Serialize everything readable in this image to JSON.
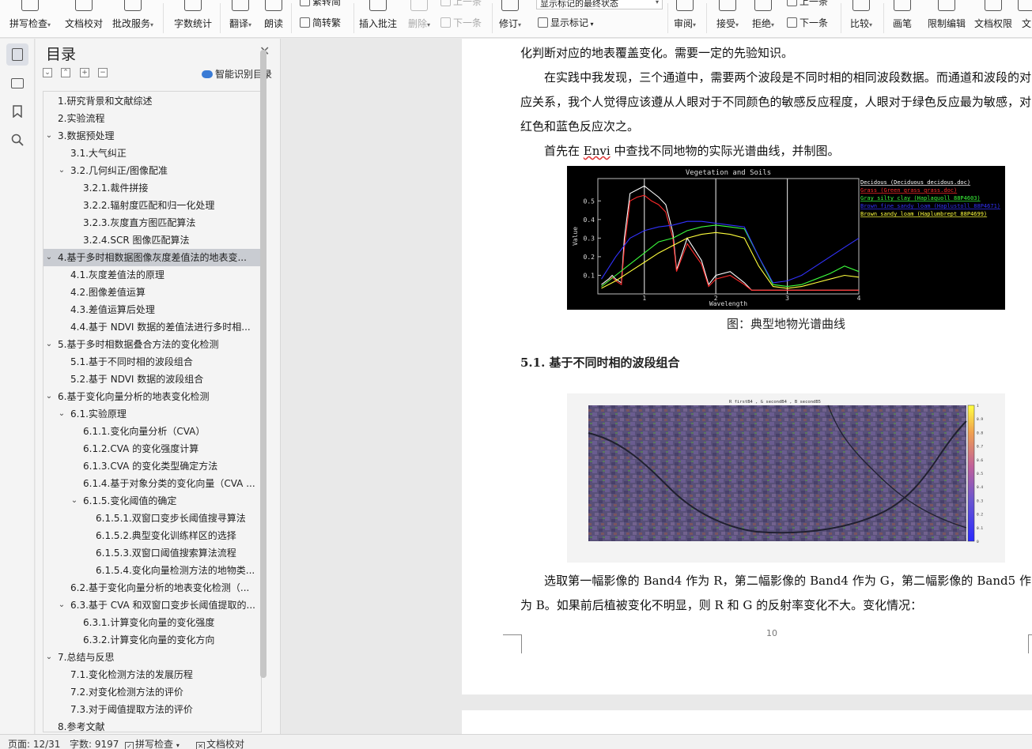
{
  "ribbon": {
    "buttons": [
      {
        "label": "拼写检查",
        "dropdown": true,
        "icon": "spellcheck-icon"
      },
      {
        "label": "文档校对",
        "dropdown": false,
        "icon": "proofread-icon"
      },
      {
        "label": "批改服务",
        "dropdown": true,
        "icon": "correction-service-icon"
      },
      {
        "label": "字数统计",
        "dropdown": false,
        "icon": "word-count-icon"
      },
      {
        "label": "翻译",
        "dropdown": true,
        "icon": "translate-icon"
      },
      {
        "label": "朗读",
        "dropdown": false,
        "icon": "read-aloud-icon"
      },
      {
        "label": "插入批注",
        "dropdown": false,
        "icon": "insert-comment-icon"
      },
      {
        "label": "删除",
        "dropdown": true,
        "icon": "delete-comment-icon",
        "disabled": true
      },
      {
        "label": "修订",
        "dropdown": true,
        "icon": "track-changes-icon"
      },
      {
        "label": "审阅",
        "dropdown": true,
        "icon": "review-icon"
      },
      {
        "label": "接受",
        "dropdown": true,
        "icon": "accept-icon"
      },
      {
        "label": "拒绝",
        "dropdown": true,
        "icon": "reject-icon"
      },
      {
        "label": "比较",
        "dropdown": true,
        "icon": "compare-icon"
      },
      {
        "label": "画笔",
        "dropdown": false,
        "icon": "pen-icon"
      },
      {
        "label": "限制编辑",
        "dropdown": false,
        "icon": "restrict-edit-icon"
      },
      {
        "label": "文档权限",
        "dropdown": false,
        "icon": "doc-permission-icon"
      },
      {
        "label": "文",
        "dropdown": false,
        "icon": "more-icon"
      }
    ],
    "traditional_top": "繁转简",
    "simplified_conv": "简转繁",
    "prev_top": "上一条",
    "next_top": "下一条",
    "markup_mode": "显示标记的最终状态",
    "show_markup": "显示标记",
    "prev_change": "上一条",
    "next_change": "下一条"
  },
  "toc": {
    "title": "目录",
    "smart_label": "智能识别目录",
    "items": [
      {
        "level": 1,
        "text": "1.研究背景和文献综述",
        "chevron": ""
      },
      {
        "level": 1,
        "text": "2.实验流程",
        "chevron": ""
      },
      {
        "level": 1,
        "text": "3.数据预处理",
        "chevron": "v"
      },
      {
        "level": 2,
        "text": "3.1.大气纠正",
        "chevron": ""
      },
      {
        "level": 2,
        "text": "3.2.几何纠正/图像配准",
        "chevron": "v"
      },
      {
        "level": 3,
        "text": "3.2.1.裁件拼接",
        "chevron": ""
      },
      {
        "level": 3,
        "text": "3.2.2.辐射度匹配和归一化处理",
        "chevron": ""
      },
      {
        "level": 3,
        "text": "3.2.3.灰度直方图匹配算法",
        "chevron": ""
      },
      {
        "level": 3,
        "text": "3.2.4.SCR 图像匹配算法",
        "chevron": ""
      },
      {
        "level": 1,
        "text": "4.基于多时相数据图像灰度差值法的地表变...",
        "chevron": "v",
        "selected": true
      },
      {
        "level": 2,
        "text": "4.1.灰度差值法的原理",
        "chevron": ""
      },
      {
        "level": 2,
        "text": "4.2.图像差值运算",
        "chevron": ""
      },
      {
        "level": 2,
        "text": "4.3.差值运算后处理",
        "chevron": ""
      },
      {
        "level": 2,
        "text": "4.4.基于 NDVI 数据的差值法进行多时相...",
        "chevron": ""
      },
      {
        "level": 1,
        "text": "5.基于多时相数据叠合方法的变化检测",
        "chevron": "v"
      },
      {
        "level": 2,
        "text": "5.1.基于不同时相的波段组合",
        "chevron": ""
      },
      {
        "level": 2,
        "text": "5.2.基于 NDVI 数据的波段组合",
        "chevron": ""
      },
      {
        "level": 1,
        "text": "6.基于变化向量分析的地表变化检测",
        "chevron": "v"
      },
      {
        "level": 2,
        "text": "6.1.实验原理",
        "chevron": "v"
      },
      {
        "level": 3,
        "text": "6.1.1.变化向量分析（CVA）",
        "chevron": ""
      },
      {
        "level": 3,
        "text": "6.1.2.CVA 的变化强度计算",
        "chevron": ""
      },
      {
        "level": 3,
        "text": "6.1.3.CVA 的变化类型确定方法",
        "chevron": ""
      },
      {
        "level": 3,
        "text": "6.1.4.基于对象分类的变化向量（CVA ...",
        "chevron": ""
      },
      {
        "level": 3,
        "text": "6.1.5.变化阈值的确定",
        "chevron": "v"
      },
      {
        "level": 4,
        "text": "6.1.5.1.双窗口变步长阈值搜寻算法",
        "chevron": ""
      },
      {
        "level": 4,
        "text": "6.1.5.2.典型变化训练样区的选择",
        "chevron": ""
      },
      {
        "level": 4,
        "text": "6.1.5.3.双窗口阈值搜索算法流程",
        "chevron": ""
      },
      {
        "level": 4,
        "text": "6.1.5.4.变化向量检测方法的地物类...",
        "chevron": ""
      },
      {
        "level": 2,
        "text": "6.2.基于变化向量分析的地表变化检测（...",
        "chevron": ""
      },
      {
        "level": 2,
        "text": "6.3.基于 CVA 和双窗口变步长阈值提取的...",
        "chevron": "v"
      },
      {
        "level": 3,
        "text": "6.3.1.计算变化向量的变化强度",
        "chevron": ""
      },
      {
        "level": 3,
        "text": "6.3.2.计算变化向量的变化方向",
        "chevron": ""
      },
      {
        "level": 1,
        "text": "7.总结与反思",
        "chevron": "v"
      },
      {
        "level": 2,
        "text": "7.1.变化检测方法的发展历程",
        "chevron": ""
      },
      {
        "level": 2,
        "text": "7.2.对变化检测方法的评价",
        "chevron": ""
      },
      {
        "level": 2,
        "text": "7.3.对于阈值提取方法的评价",
        "chevron": ""
      },
      {
        "level": 1,
        "text": "8.参考文献",
        "chevron": ""
      }
    ]
  },
  "doc": {
    "p1": "化判断对应的地表覆盖变化。需要一定的先验知识。",
    "p2": "在实践中我发现，三个通道中，需要两个波段是不同时相的相同波段数据。而通道和波段的对应关系，我个人觉得应该遵从人眼对于不同颜色的敏感反应程度，人眼对于绿色反应最为敏感，对红色和蓝色反应次之。",
    "p3_a": "首先在 ",
    "p3_b": "Envi",
    "p3_c": " 中查找不同地物的实际光谱曲线，并制图。",
    "fig1_caption": "图：典型地物光谱曲线",
    "section_title": "5.1. 基于不同时相的波段组合",
    "p4": "选取第一幅影像的 Band4 作为 R，第二幅影像的 Band4 作为 G，第二幅影像的 Band5 作为 B。如果前后植被变化不明显，则 R 和 G 的反射率变化不大。变化情况：",
    "page_number": "10"
  },
  "chart_data": {
    "type": "line",
    "title": "Vegetation and Soils",
    "xlabel": "Wavelength",
    "ylabel": "Value",
    "xlim": [
      0.35,
      4.0
    ],
    "ylim": [
      0,
      0.62
    ],
    "xticks": [
      "1",
      "2",
      "3",
      "4"
    ],
    "yticks": [
      "0.1",
      "0.2",
      "0.3",
      "0.4",
      "0.5"
    ],
    "background": "#000000",
    "legend_position": "right",
    "series": [
      {
        "name": "Decidous (Deciduous decidous.doc)",
        "color": "#ffffff",
        "x": [
          0.4,
          0.5,
          0.55,
          0.6,
          0.68,
          0.72,
          0.8,
          0.9,
          1.0,
          1.1,
          1.2,
          1.3,
          1.4,
          1.45,
          1.6,
          1.8,
          1.9,
          2.0,
          2.2,
          2.4,
          2.5,
          3.0,
          3.5,
          4.0
        ],
        "y": [
          0.05,
          0.08,
          0.1,
          0.08,
          0.06,
          0.3,
          0.54,
          0.56,
          0.58,
          0.55,
          0.52,
          0.48,
          0.33,
          0.13,
          0.3,
          0.18,
          0.05,
          0.1,
          0.12,
          0.06,
          0.02,
          0.02,
          0.02,
          0.02
        ]
      },
      {
        "name": "Grass (Green grass grass.doc)",
        "color": "#ff2a2a",
        "x": [
          0.4,
          0.5,
          0.55,
          0.6,
          0.68,
          0.72,
          0.8,
          0.9,
          1.0,
          1.1,
          1.2,
          1.3,
          1.4,
          1.45,
          1.6,
          1.8,
          1.9,
          2.0,
          2.2,
          2.4,
          2.5,
          3.0,
          3.5,
          4.0
        ],
        "y": [
          0.04,
          0.07,
          0.09,
          0.07,
          0.05,
          0.25,
          0.5,
          0.52,
          0.53,
          0.5,
          0.48,
          0.44,
          0.3,
          0.12,
          0.27,
          0.16,
          0.04,
          0.08,
          0.1,
          0.05,
          0.02,
          0.02,
          0.02,
          0.02
        ]
      },
      {
        "name": "Gray silty clay (Haplaquoll 88P4603)",
        "color": "#3cff3c",
        "x": [
          0.4,
          0.6,
          0.8,
          1.0,
          1.2,
          1.4,
          1.6,
          1.8,
          2.0,
          2.2,
          2.4,
          2.6,
          2.8,
          3.0,
          3.2,
          3.4,
          3.6,
          3.8,
          4.0
        ],
        "y": [
          0.04,
          0.1,
          0.16,
          0.22,
          0.28,
          0.3,
          0.34,
          0.36,
          0.37,
          0.36,
          0.35,
          0.2,
          0.05,
          0.04,
          0.05,
          0.08,
          0.11,
          0.15,
          0.12
        ]
      },
      {
        "name": "Brown fine sandy loam (Haplustoll 88P4671)",
        "color": "#3232ff",
        "x": [
          0.4,
          0.6,
          0.8,
          1.0,
          1.2,
          1.4,
          1.6,
          1.8,
          2.0,
          2.2,
          2.4,
          2.6,
          2.8,
          3.0,
          3.2,
          3.4,
          3.6,
          3.8,
          4.0
        ],
        "y": [
          0.08,
          0.2,
          0.3,
          0.34,
          0.36,
          0.37,
          0.39,
          0.39,
          0.38,
          0.37,
          0.36,
          0.2,
          0.06,
          0.07,
          0.1,
          0.15,
          0.2,
          0.25,
          0.3
        ]
      },
      {
        "name": "Brown sandy loam (Haplumbrept 88P4699)",
        "color": "#ffff3c",
        "x": [
          0.4,
          0.6,
          0.8,
          1.0,
          1.2,
          1.4,
          1.6,
          1.8,
          2.0,
          2.2,
          2.4,
          2.6,
          2.8,
          3.0,
          3.2,
          3.4,
          3.6,
          3.8,
          4.0
        ],
        "y": [
          0.03,
          0.07,
          0.12,
          0.17,
          0.22,
          0.26,
          0.3,
          0.32,
          0.33,
          0.32,
          0.3,
          0.15,
          0.04,
          0.03,
          0.04,
          0.06,
          0.08,
          0.1,
          0.09
        ]
      }
    ]
  },
  "fig2": {
    "title": "R firstB4 , G secondB4 , B secondB5",
    "colorbar_ticks": [
      "1",
      "0.9",
      "0.8",
      "0.7",
      "0.6",
      "0.5",
      "0.4",
      "0.3",
      "0.2",
      "0.1",
      "0"
    ]
  },
  "statusbar": {
    "page": "页面: 12/31",
    "words": "字数: 9197",
    "spell": "拼写检查",
    "proof": "文档校对"
  },
  "colors": {
    "accent": "#3a7bd5",
    "selection": "#c9ccd2"
  }
}
